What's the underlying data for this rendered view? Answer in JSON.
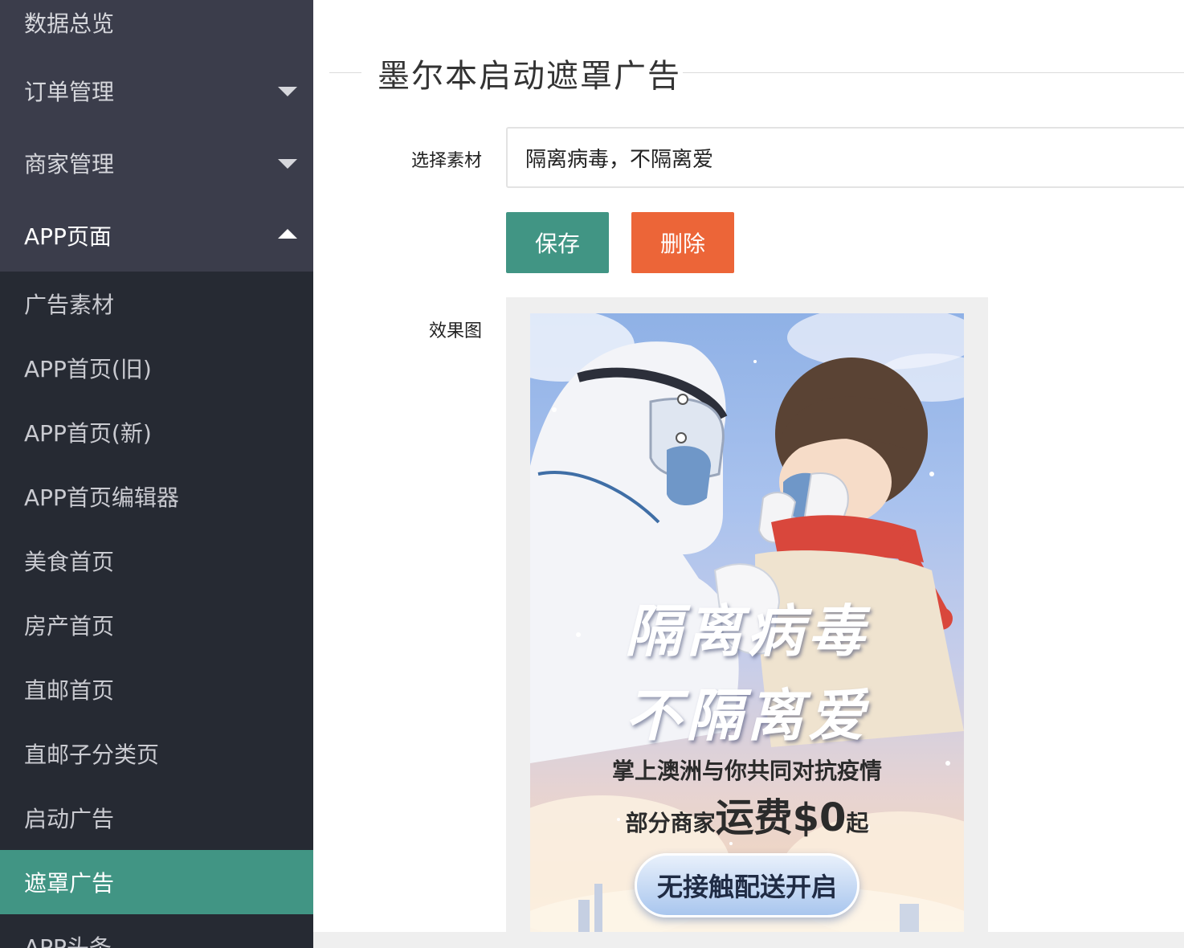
{
  "sidebar": {
    "top_items": [
      {
        "label": "数据总览",
        "caret": "none"
      },
      {
        "label": "订单管理",
        "caret": "down"
      },
      {
        "label": "商家管理",
        "caret": "down"
      },
      {
        "label": "APP页面",
        "caret": "up"
      }
    ],
    "sub_items": [
      {
        "label": "广告素材"
      },
      {
        "label": "APP首页(旧)"
      },
      {
        "label": "APP首页(新)"
      },
      {
        "label": "APP首页编辑器"
      },
      {
        "label": "美食首页"
      },
      {
        "label": "房产首页"
      },
      {
        "label": "直邮首页"
      },
      {
        "label": "直邮子分类页"
      },
      {
        "label": "启动广告"
      },
      {
        "label": "遮罩广告"
      },
      {
        "label": "APP头条"
      }
    ],
    "active_sub": "遮罩广告",
    "colors": {
      "bg": "#262a33",
      "top_bg": "#3b3d4b",
      "active": "#419584"
    }
  },
  "main": {
    "legend_title": "墨尔本启动遮罩广告",
    "material_label": "选择素材",
    "material_value": "隔离病毒，不隔离爱",
    "save_label": "保存",
    "delete_label": "删除",
    "preview_label": "效果图",
    "colors": {
      "save": "#419584",
      "delete": "#ec6538"
    }
  },
  "poster": {
    "title_line1": "隔离病毒",
    "title_line2": "不隔离爱",
    "sub_line1": "掌上澳洲与你共同对抗疫情",
    "sub_line2_prefix": "部分商家",
    "sub_line2_big": "运费$0",
    "sub_line2_suffix": "起",
    "cta": "无接触配送开启"
  }
}
